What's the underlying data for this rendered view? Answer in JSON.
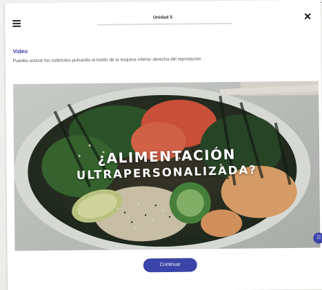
{
  "header": {
    "unit_title": "Unidad 5",
    "menu_icon": "hamburger-menu-icon",
    "close_icon": "close-icon",
    "close_glyph": "✕"
  },
  "content": {
    "section_label": "Video",
    "instructions": "Puedes activar los subtítulos pulsando el botón de la esquina inferior derecha del reproductor."
  },
  "video": {
    "title_line1": "¿ALIMENTACIÓN",
    "title_line2": "ULTRAPERSONALIZADA?",
    "subtitles_icon": "subtitles-icon",
    "subtitles_glyph": "☷"
  },
  "footer": {
    "continue_label": "Continuar"
  },
  "colors": {
    "accent": "#3b44a8",
    "label": "#3b3fa6"
  }
}
